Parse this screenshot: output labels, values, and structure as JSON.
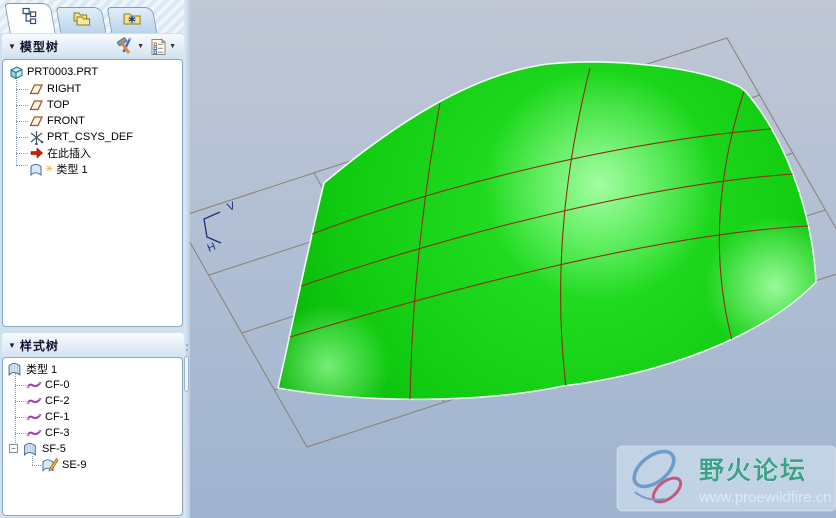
{
  "window": {
    "tabs": [
      {
        "icon": "model-tree-icon"
      },
      {
        "icon": "folder-browser-icon"
      },
      {
        "icon": "favorites-folder-icon"
      }
    ]
  },
  "model_tree": {
    "header": "模型树",
    "items": [
      {
        "label": "PRT0003.PRT",
        "icon": "part-icon"
      },
      {
        "label": "RIGHT",
        "icon": "datum-plane-icon"
      },
      {
        "label": "TOP",
        "icon": "datum-plane-icon"
      },
      {
        "label": "FRONT",
        "icon": "datum-plane-icon"
      },
      {
        "label": "PRT_CSYS_DEF",
        "icon": "csys-icon"
      },
      {
        "label": "在此插入",
        "icon": "insert-here-arrow-icon"
      },
      {
        "label": "类型 1",
        "icon": "style-feature-icon"
      }
    ]
  },
  "style_tree": {
    "header": "样式树",
    "items": [
      {
        "label": "类型 1",
        "icon": "style-surface-icon"
      },
      {
        "label": "CF-0",
        "icon": "curve-icon"
      },
      {
        "label": "CF-2",
        "icon": "curve-icon"
      },
      {
        "label": "CF-1",
        "icon": "curve-icon"
      },
      {
        "label": "CF-3",
        "icon": "curve-icon"
      },
      {
        "label": "SF-5",
        "icon": "surface-icon",
        "expanded": true
      },
      {
        "label": "SE-9",
        "icon": "surface-edit-icon"
      }
    ]
  },
  "viewport": {
    "v_axis_label": "V",
    "h_axis_label": "H"
  },
  "watermark": {
    "title": "野火论坛",
    "url": "www.proewildfire.cn"
  },
  "glyphs": {
    "header_arrow": "▼",
    "dropdown_arrow": "▼",
    "collapse_minus": "−",
    "star": "✳"
  },
  "colors": {
    "surface_green": "#12cd12",
    "surface_highlight": "#9dff9d",
    "isoparam_line": "#8f2f10",
    "plane_wireframe": "#8a8172",
    "viewport_top": "#c0c7d5",
    "viewport_bottom": "#9fb3cf",
    "axis_label_blue": "#1b2f7e",
    "insert_arrow_red": "#cc2200",
    "curve_purple": "#a23ab0",
    "watermark_title_green": "#3da189",
    "watermark_url_blue": "#dcebf7"
  }
}
